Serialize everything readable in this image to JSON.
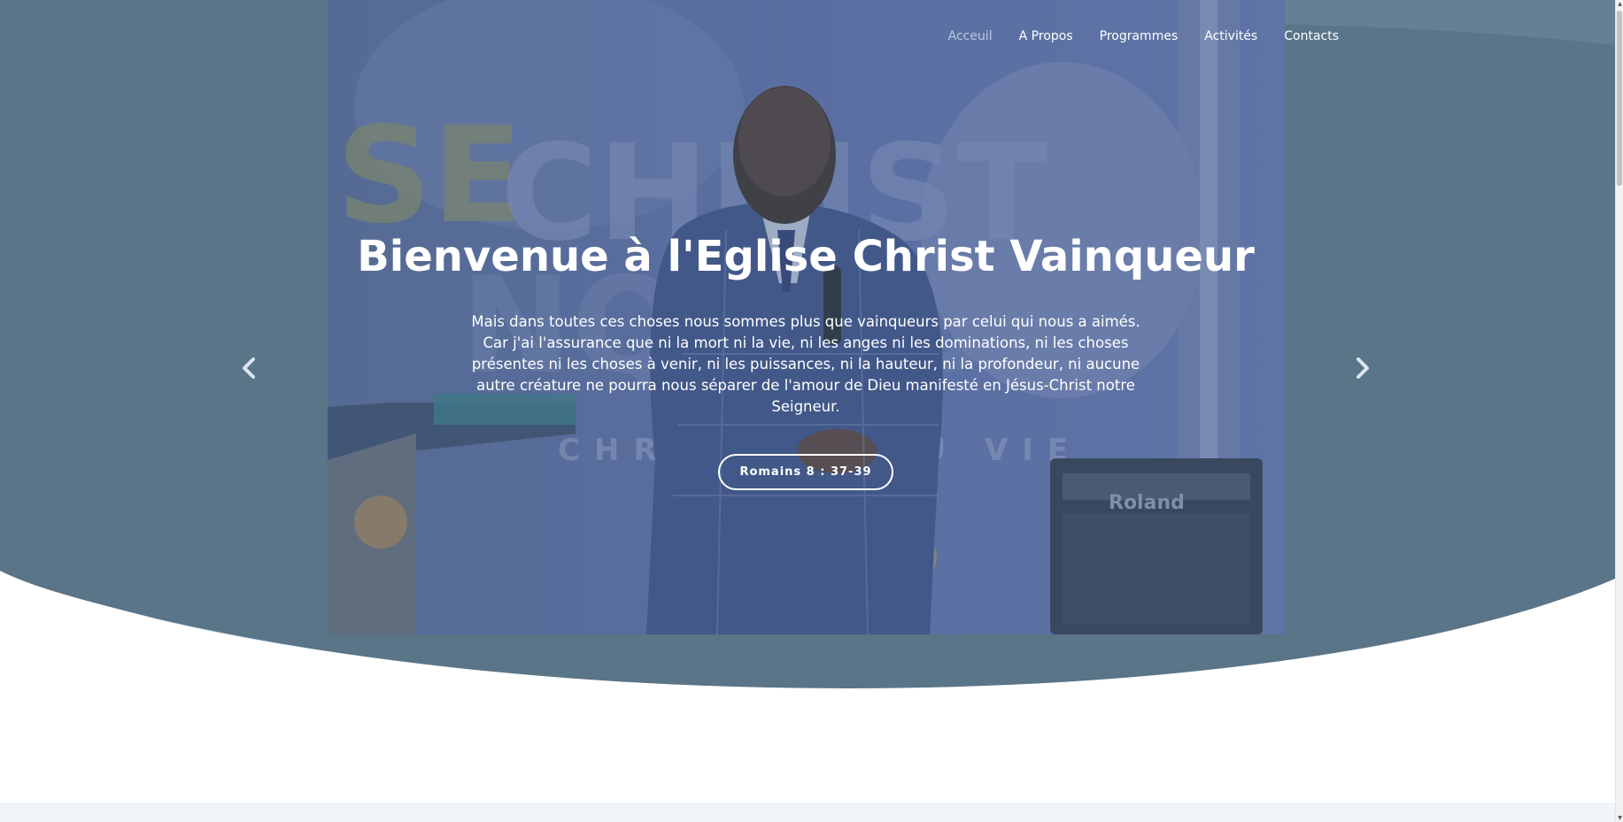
{
  "nav": {
    "items": [
      {
        "label": "Acceuil",
        "active": true
      },
      {
        "label": "A Propos",
        "active": false
      },
      {
        "label": "Programmes",
        "active": false
      },
      {
        "label": "Activités",
        "active": false
      },
      {
        "label": "Contacts",
        "active": false
      }
    ]
  },
  "hero": {
    "title": "Bienvenue à l'Eglise Christ Vainqueur",
    "text": "Mais dans toutes ces choses nous sommes plus que vainqueurs par celui qui nous a aimés. Car j'ai l'assurance que ni la mort ni la vie, ni les anges ni les dominations, ni les choses présentes ni les choses à venir, ni les puissances, ni la hauteur, ni la profondeur, ni aucune autre créature ne pourra nous séparer de l'amour de Dieu manifesté en Jésus-Christ notre Seigneur.",
    "button_label": "Romains 8 : 37-39",
    "photo_background_text": "SE CHRIST VAINQUEUR",
    "photo_sub_text": "CHRIST EST U  VIE",
    "amplifier_brand": "Roland"
  },
  "carousel": {
    "prev_icon": "chevron-left-icon",
    "next_icon": "chevron-right-icon"
  },
  "colors": {
    "hero_overlay": "#5a7488",
    "wave_light": "#d3e4ee",
    "nav_active": "#b9cbe2",
    "text": "#ffffff",
    "page_background": "#ffffff"
  }
}
